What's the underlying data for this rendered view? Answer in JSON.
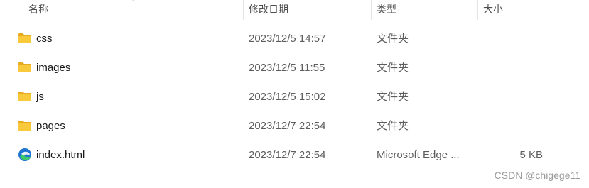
{
  "columns": {
    "name": "名称",
    "date": "修改日期",
    "type": "类型",
    "size": "大小"
  },
  "files": [
    {
      "name": "css",
      "date": "2023/12/5 14:57",
      "type": "文件夹",
      "size": "",
      "icon": "folder-icon"
    },
    {
      "name": "images",
      "date": "2023/12/5 11:55",
      "type": "文件夹",
      "size": "",
      "icon": "folder-icon"
    },
    {
      "name": "js",
      "date": "2023/12/5 15:02",
      "type": "文件夹",
      "size": "",
      "icon": "folder-icon"
    },
    {
      "name": "pages",
      "date": "2023/12/7 22:54",
      "type": "文件夹",
      "size": "",
      "icon": "folder-icon"
    },
    {
      "name": "index.html",
      "date": "2023/12/7 22:54",
      "type": "Microsoft Edge ...",
      "size": "5 KB",
      "icon": "edge-html-icon"
    }
  ],
  "watermark": "CSDN @chigege11",
  "colors": {
    "folder": "#f8c93a",
    "folder_back": "#e8ab1f",
    "edge_blue": "#1f74d1",
    "edge_green": "#3ec96b"
  }
}
